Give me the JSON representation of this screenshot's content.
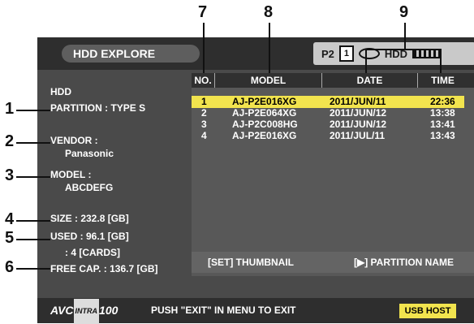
{
  "window": {
    "title": "HDD EXPLORE"
  },
  "status": {
    "p2_label": "P2",
    "slot_number": "1",
    "hdd_label": "HDD"
  },
  "device": {
    "section_label": "HDD",
    "partition": "PARTITION : TYPE S",
    "vendor_label": "VENDOR :",
    "vendor_value": "Panasonic",
    "model_label": "MODEL :",
    "model_value": "ABCDEFG",
    "size": "SIZE : 232.8 [GB]",
    "used": "USED :  96.1 [GB]",
    "used_cards": ":  4 [CARDS]",
    "free": "FREE CAP. : 136.7 [GB]"
  },
  "table": {
    "headers": {
      "no": "NO.",
      "model": "MODEL",
      "date": "DATE",
      "time": "TIME"
    },
    "rows": [
      {
        "no": "1",
        "model": "AJ-P2E016XG",
        "date": "2011/JUN/11",
        "time": "22:36",
        "selected": true
      },
      {
        "no": "2",
        "model": "AJ-P2E064XG",
        "date": "2011/JUN/12",
        "time": "13:38"
      },
      {
        "no": "3",
        "model": "AJ-P2C008HG",
        "date": "2011/JUN/12",
        "time": "13:41"
      },
      {
        "no": "4",
        "model": "AJ-P2E016XG",
        "date": "2011/JUL/11",
        "time": "13:43"
      }
    ]
  },
  "hints": {
    "left": "[SET] THUMBNAIL",
    "right": "[▶] PARTITION NAME"
  },
  "footer": {
    "logo_avc": "AVC",
    "logo_intra": "INTRA",
    "logo_100": "100",
    "message": "PUSH \"EXIT\" IN MENU TO EXIT",
    "usb_button": "USB HOST"
  },
  "callouts": [
    "1",
    "2",
    "3",
    "4",
    "5",
    "6",
    "7",
    "8",
    "9"
  ],
  "colors": {
    "highlight": "#f2e44e",
    "screen_bg": "#4a4a4a",
    "bar_bg": "#2e2e2e"
  }
}
